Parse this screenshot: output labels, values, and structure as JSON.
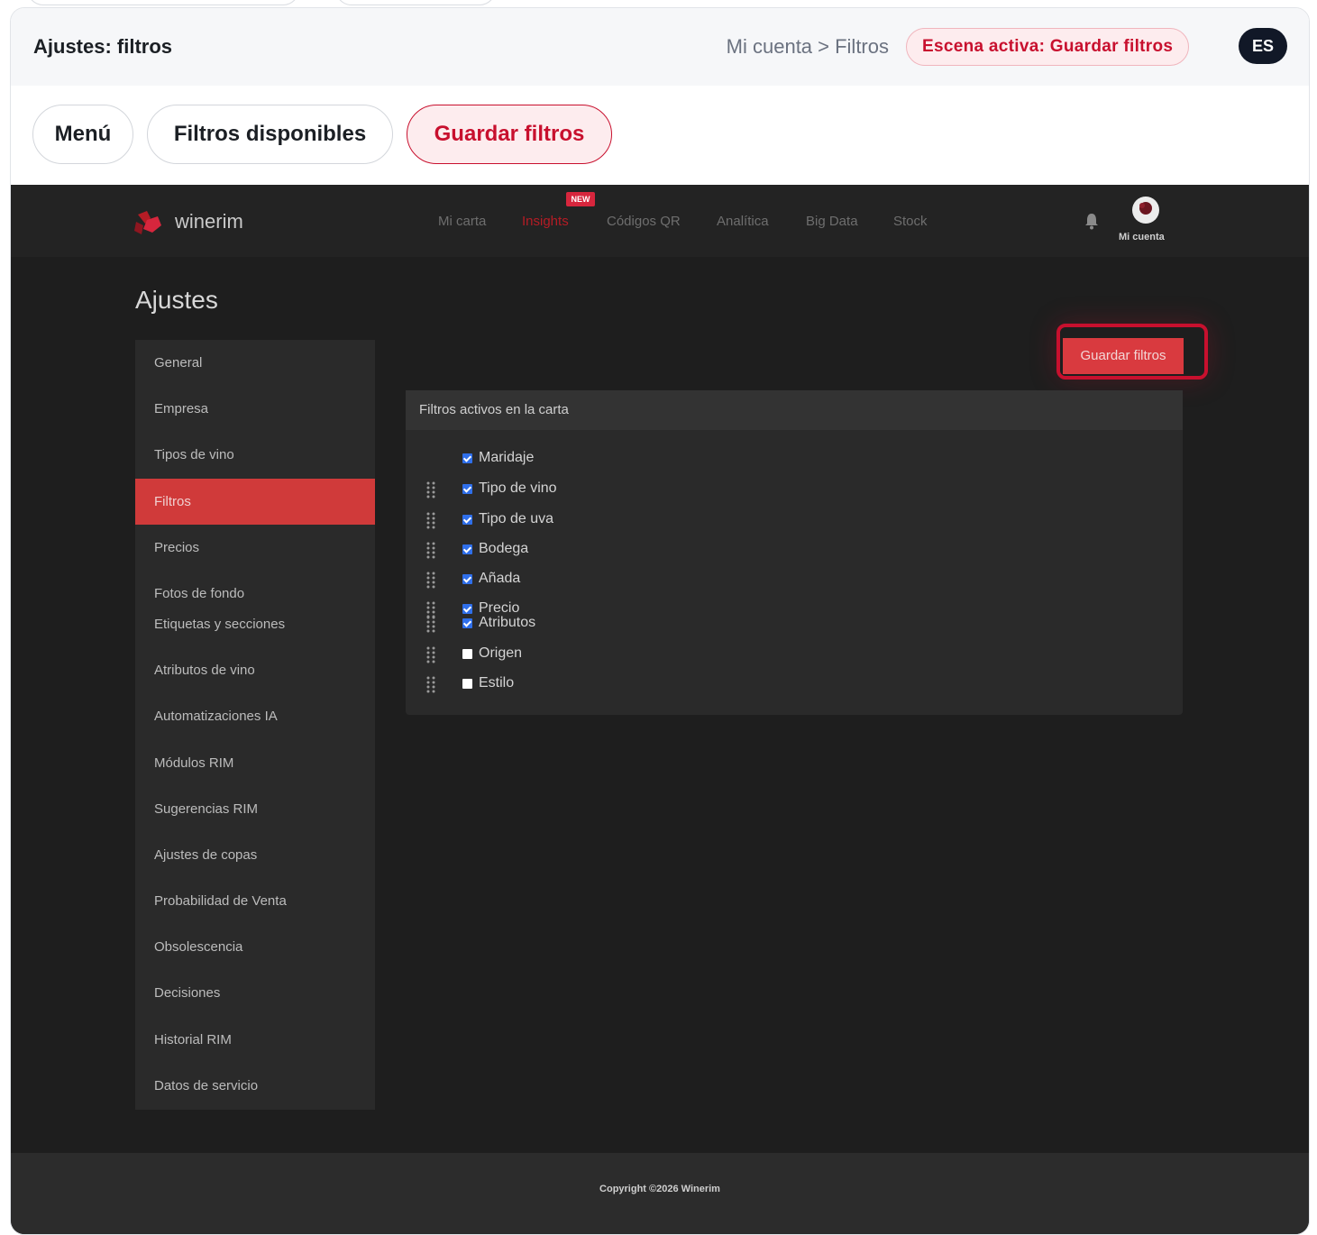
{
  "header": {
    "title": "Ajustes: filtros",
    "breadcrumb": "Mi cuenta > Filtros",
    "scene_badge": "Escena activa: Guardar filtros",
    "language": "ES"
  },
  "tabs": [
    {
      "label": "Menú"
    },
    {
      "label": "Filtros disponibles"
    },
    {
      "label": "Guardar filtros",
      "active": true
    }
  ],
  "app": {
    "logo_text": "winerim",
    "nav": {
      "items": [
        "Mi carta",
        "Insights",
        "Códigos QR",
        "Analítica",
        "Big Data",
        "Stock"
      ],
      "active": "Insights",
      "new_tag": "NEW",
      "account_label": "Mi cuenta"
    },
    "page_title": "Ajustes",
    "sidebar": [
      "General",
      "Empresa",
      "Tipos de vino",
      "Filtros",
      "Precios",
      "Fotos de fondo",
      "Etiquetas y secciones",
      "Atributos de vino",
      "Automatizaciones IA",
      "Módulos RIM",
      "Sugerencias RIM",
      "Ajustes de copas",
      "Probabilidad de Venta",
      "Obsolescencia",
      "Decisiones",
      "Historial RIM",
      "Datos de servicio"
    ],
    "sidebar_active": "Filtros",
    "save_button": "Guardar filtros",
    "filters_title": "Filtros activos en la carta",
    "filters": [
      {
        "label": "Maridaje",
        "checked": true
      },
      {
        "label": "Tipo de vino",
        "checked": true
      },
      {
        "label": "Tipo de uva",
        "checked": true
      },
      {
        "label": "Bodega",
        "checked": true
      },
      {
        "label": "Añada",
        "checked": true
      },
      {
        "label": "Precio",
        "checked": true
      },
      {
        "label": "Atributos",
        "checked": true
      },
      {
        "label": "Origen",
        "checked": false
      },
      {
        "label": "Estilo",
        "checked": false
      }
    ],
    "footer": "Copyright ©2026 Winerim"
  },
  "colors": {
    "accent": "#c8102e",
    "app_background": "#1e1e1e",
    "sidebar_active": "#d03a3a",
    "checkbox": "#2f6fea"
  }
}
